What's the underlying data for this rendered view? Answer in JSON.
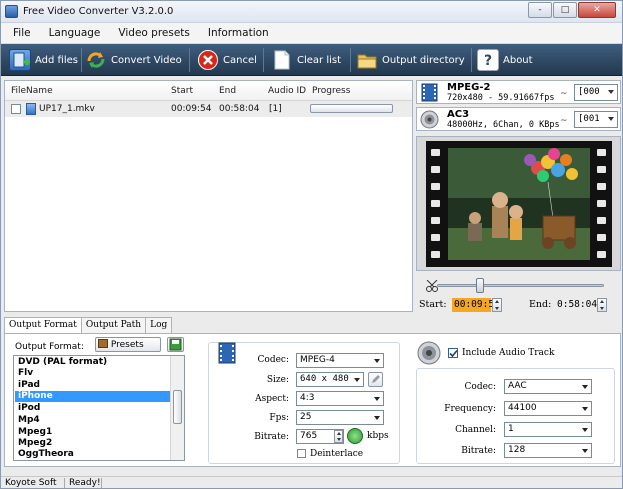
{
  "window": {
    "title": "Free Video Converter V3.2.0.0",
    "controls": [
      "-",
      "□",
      "✕"
    ]
  },
  "menu": [
    "File",
    "Language",
    "Video presets",
    "Information"
  ],
  "toolbar": {
    "add_files": "Add files",
    "convert_video": "Convert Video",
    "cancel": "Cancel",
    "clear_list": "Clear list",
    "output_directory": "Output directory",
    "about": "About"
  },
  "filelist": {
    "columns": [
      "FileName",
      "Start",
      "End",
      "Audio ID",
      "Progress"
    ],
    "rows": [
      {
        "name": "UP17_1.mkv",
        "start": "00:09:54",
        "end": "00:58:04",
        "audio_id": "[1]",
        "progress": 0
      }
    ]
  },
  "video_stream": {
    "codec": "MPEG-2",
    "details": "720x480 - 59.91667fps",
    "tilde": "~",
    "track": "[000"
  },
  "audio_stream": {
    "codec": "AC3",
    "details": "48000Hz, 6Chan, 0 KBps",
    "tilde": "~",
    "track": "[001"
  },
  "trim": {
    "start_label": "Start:",
    "start": "00:09:54",
    "end_label": "End:",
    "end": "0:58:04"
  },
  "tabs": [
    "Output Format",
    "Output Path",
    "Log"
  ],
  "output_format": {
    "label": "Output Format:",
    "presets_label": "Presets",
    "items": [
      "DVD (PAL format)",
      "Flv",
      "iPad",
      "iPhone",
      "iPod",
      "Mp4",
      "Mpeg1",
      "Mpeg2",
      "OggTheora"
    ],
    "selected": "iPhone"
  },
  "video_settings": {
    "codec_label": "Codec:",
    "codec": "MPEG-4",
    "size_label": "Size:",
    "size": "640 x 480",
    "aspect_label": "Aspect:",
    "aspect": "4:3",
    "fps_label": "Fps:",
    "fps": "25",
    "bitrate_label": "Bitrate:",
    "bitrate": "765",
    "bitrate_unit": "kbps",
    "deinterlace_label": "Deinterlace"
  },
  "audio_settings": {
    "include_label": "Include Audio Track",
    "codec_label": "Codec:",
    "codec": "AAC",
    "frequency_label": "Frequency:",
    "frequency": "44100",
    "channel_label": "Channel:",
    "channel": "1",
    "bitrate_label": "Bitrate:",
    "bitrate": "128"
  },
  "status": {
    "company": "Koyote Soft",
    "state": "Ready!"
  },
  "colors": {
    "toolbar_bg": "#2e4762",
    "selection": "#3399ff",
    "time_highlight": "#f5a623"
  }
}
